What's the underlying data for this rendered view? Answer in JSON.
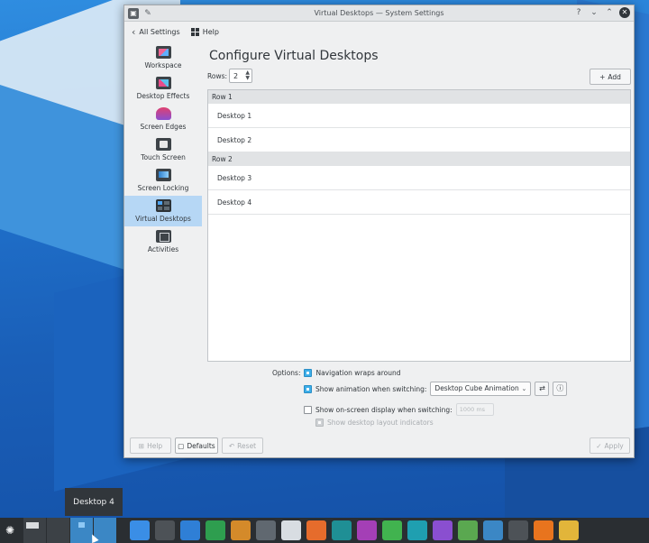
{
  "window": {
    "title": "Virtual Desktops — System Settings",
    "controls": {
      "help": "?",
      "minimize": "⌄",
      "maximize": "⌃",
      "close": "✕"
    }
  },
  "toolbar": {
    "back_label": "All Settings",
    "help_label": "Help"
  },
  "sidebar": {
    "items": [
      {
        "label": "Workspace",
        "icon": "workspace-icon"
      },
      {
        "label": "Desktop Effects",
        "icon": "desktop-effects-icon"
      },
      {
        "label": "Screen Edges",
        "icon": "screen-edges-icon"
      },
      {
        "label": "Touch Screen",
        "icon": "touch-screen-icon"
      },
      {
        "label": "Screen Locking",
        "icon": "screen-locking-icon"
      },
      {
        "label": "Virtual Desktops",
        "icon": "virtual-desktops-icon",
        "active": true
      },
      {
        "label": "Activities",
        "icon": "activities-icon"
      }
    ]
  },
  "main": {
    "title": "Configure Virtual Desktops",
    "rows_label": "Rows:",
    "rows_value": "2",
    "add_label": "Add",
    "rows": [
      {
        "header": "Row 1",
        "desktops": [
          "Desktop 1",
          "Desktop 2"
        ]
      },
      {
        "header": "Row 2",
        "desktops": [
          "Desktop 3",
          "Desktop 4"
        ]
      }
    ]
  },
  "options": {
    "label": "Options:",
    "navigation_wraps": {
      "label": "Navigation wraps around",
      "checked": true
    },
    "show_animation": {
      "label": "Show animation when switching:",
      "checked": true
    },
    "animation_value": "Desktop Cube Animation",
    "show_osd": {
      "label": "Show on-screen display when switching:",
      "checked": false
    },
    "osd_duration": "1000 ms",
    "show_layout": {
      "label": "Show desktop layout indicators",
      "checked": true,
      "disabled": true
    }
  },
  "buttons": {
    "help": "Help",
    "defaults": "Defaults",
    "reset": "Reset",
    "apply": "Apply"
  },
  "tooltip": "Desktop 4",
  "taskbar": {
    "tasks": [
      {
        "icon": "settings-app-icon",
        "color": "#3a8ee6"
      },
      {
        "icon": "terminal-icon",
        "color": "#4d5257"
      },
      {
        "icon": "file-manager-icon",
        "color": "#2f7fd6"
      },
      {
        "icon": "torrent-icon",
        "color": "#2e9e4f"
      },
      {
        "icon": "media-player-icon",
        "color": "#d48a2a"
      },
      {
        "icon": "clapper-icon",
        "color": "#606870"
      },
      {
        "icon": "text-editor-icon",
        "color": "#d8dde2"
      },
      {
        "icon": "paint-icon",
        "color": "#e66c2c"
      },
      {
        "icon": "ide-icon-1",
        "color": "#1f8f95"
      },
      {
        "icon": "ide-icon-2",
        "color": "#a43fb6"
      },
      {
        "icon": "ide-icon-3",
        "color": "#41b34f"
      },
      {
        "icon": "ide-icon-4",
        "color": "#1f9fb0"
      },
      {
        "icon": "ide-icon-5",
        "color": "#8a4fd0"
      },
      {
        "icon": "game-icon",
        "color": "#5aa850"
      },
      {
        "icon": "image-viewer-icon",
        "color": "#3b87c5"
      },
      {
        "icon": "presentation-icon",
        "color": "#4d5257"
      },
      {
        "icon": "firefox-icon",
        "color": "#e8741e"
      },
      {
        "icon": "gallery-icon",
        "color": "#e2b53a"
      }
    ]
  }
}
